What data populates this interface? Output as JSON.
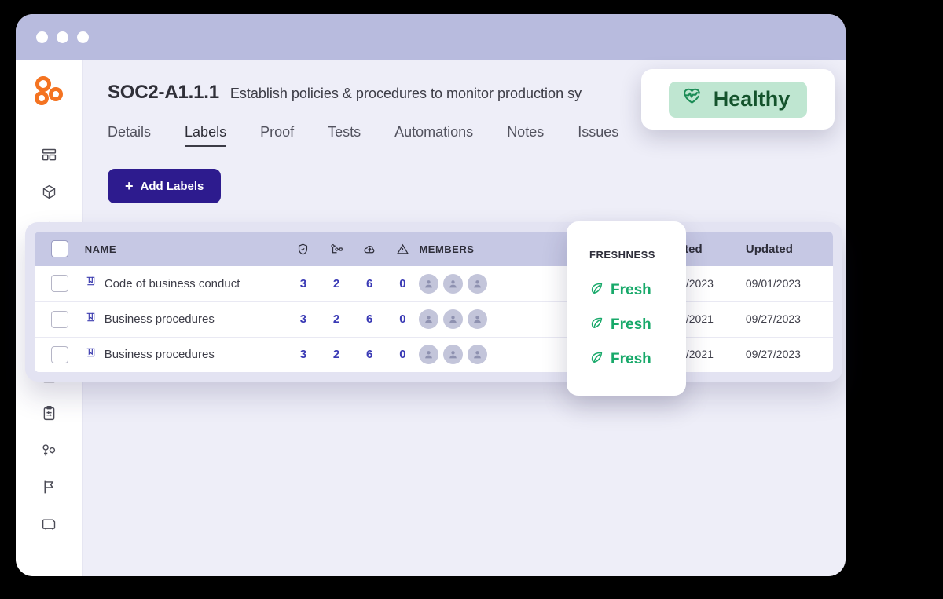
{
  "window": {
    "titlebar_dots": [
      "close-dot",
      "minimize-dot",
      "maximize-dot"
    ]
  },
  "sidebar": {
    "logo": "three-rings-logo",
    "items": [
      {
        "icon": "dashboard-icon"
      },
      {
        "icon": "package-icon"
      },
      {
        "icon": "shield-check-icon"
      },
      {
        "icon": "hierarchy-icon"
      },
      {
        "icon": "bookmark-flag-icon"
      },
      {
        "icon": "cloud-upload-icon"
      },
      {
        "icon": "list-search-icon"
      },
      {
        "icon": "clipboard-settings-icon"
      },
      {
        "icon": "key-settings-icon"
      },
      {
        "icon": "flag-icon"
      },
      {
        "icon": "inbox-icon"
      }
    ]
  },
  "header": {
    "code": "SOC2-A1.1.1",
    "subject": "Establish policies & procedures to monitor production sy"
  },
  "tabs": [
    {
      "label": "Details",
      "active": false
    },
    {
      "label": "Labels",
      "active": true
    },
    {
      "label": "Proof",
      "active": false
    },
    {
      "label": "Tests",
      "active": false
    },
    {
      "label": "Automations",
      "active": false
    },
    {
      "label": "Notes",
      "active": false
    },
    {
      "label": "Issues",
      "active": false
    }
  ],
  "toolbar": {
    "add_labels_label": "Add Labels",
    "add_labels_plus": "+"
  },
  "table": {
    "columns": {
      "name": "NAME",
      "icon_shield": "shield-icon",
      "icon_hierarchy": "hierarchy-icon",
      "icon_cloud": "cloud-upload-icon",
      "icon_warning": "warning-triangle-icon",
      "members": "MEMBERS",
      "created": "Created",
      "updated": "Updated"
    },
    "rows": [
      {
        "name": "Code of business conduct",
        "shield": "3",
        "hierarchy": "2",
        "cloud": "6",
        "warning": "0",
        "members": 3,
        "created": "03/17/2023",
        "updated": "09/01/2023"
      },
      {
        "name": "Business procedures",
        "shield": "3",
        "hierarchy": "2",
        "cloud": "6",
        "warning": "0",
        "members": 3,
        "created": "01/04/2021",
        "updated": "09/27/2023"
      },
      {
        "name": "Business procedures",
        "shield": "3",
        "hierarchy": "2",
        "cloud": "6",
        "warning": "0",
        "members": 3,
        "created": "01/04/2021",
        "updated": "09/27/2023"
      }
    ]
  },
  "healthy_card": {
    "icon": "heart-pulse-icon",
    "label": "Healthy"
  },
  "freshness_card": {
    "title": "FRESHNESS",
    "rows": [
      {
        "icon": "leaf-icon",
        "label": "Fresh"
      },
      {
        "icon": "leaf-icon",
        "label": "Fresh"
      },
      {
        "icon": "leaf-icon",
        "label": "Fresh"
      }
    ]
  },
  "colors": {
    "titlebar": "#b8bbde",
    "content_bg": "#eeeef8",
    "table_header": "#c6c8e4",
    "accent_button": "#2d1b8e",
    "number_blue": "#3a3ab5",
    "fresh_green": "#18a96a",
    "healthy_pill": "#bfe6d1",
    "healthy_text": "#14532c",
    "logo_orange": "#f47321"
  }
}
